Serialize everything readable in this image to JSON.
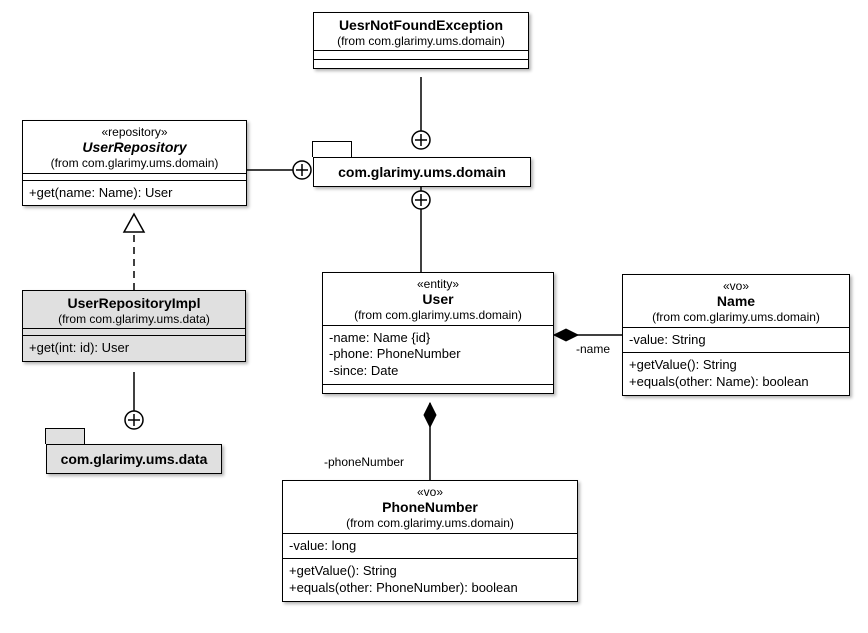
{
  "classes": {
    "exception": {
      "title": "UesrNotFoundException",
      "from": "(from com.glarimy.ums.domain)"
    },
    "repo": {
      "stereo": "«repository»",
      "title": "UserRepository",
      "from": "(from com.glarimy.ums.domain)",
      "ops": "+get(name: Name): User"
    },
    "repoImpl": {
      "title": "UserRepositoryImpl",
      "from": "(from com.glarimy.ums.data)",
      "ops": "+get(int: id): User"
    },
    "user": {
      "stereo": "«entity»",
      "title": "User",
      "from": "(from com.glarimy.ums.domain)",
      "attr1": "-name: Name {id}",
      "attr2": "-phone: PhoneNumber",
      "attr3": "-since: Date"
    },
    "name": {
      "stereo": "«vo»",
      "title": "Name",
      "from": "(from com.glarimy.ums.domain)",
      "attr": "-value: String",
      "op1": "+getValue(): String",
      "op2": "+equals(other: Name): boolean"
    },
    "phone": {
      "stereo": "«vo»",
      "title": "PhoneNumber",
      "from": "(from com.glarimy.ums.domain)",
      "attr": "-value: long",
      "op1": "+getValue(): String",
      "op2": "+equals(other: PhoneNumber): boolean"
    }
  },
  "packages": {
    "domain": "com.glarimy.ums.domain",
    "data": "com.glarimy.ums.data"
  },
  "labels": {
    "nameRole": "-name",
    "phoneRole": "-phoneNumber"
  }
}
